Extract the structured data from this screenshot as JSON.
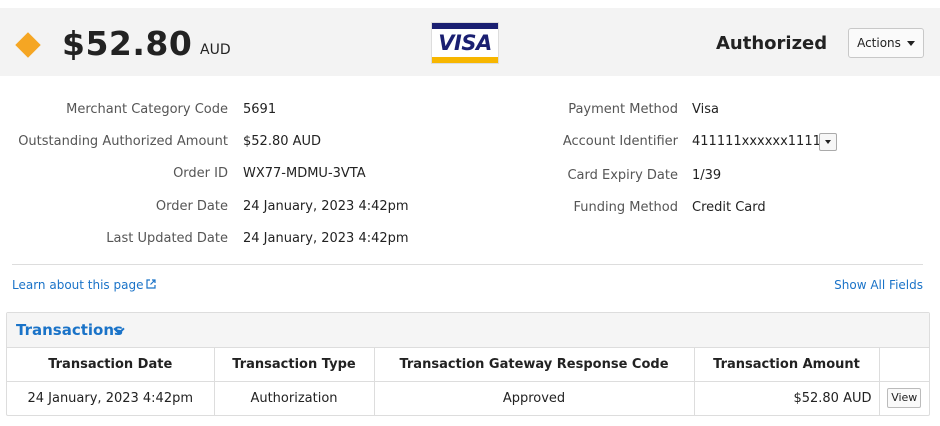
{
  "header": {
    "amount": "$52.80",
    "currency": "AUD",
    "card_brand": "VISA",
    "status": "Authorized",
    "actions_label": "Actions",
    "status_icon_color": "#f5a623",
    "brand_blue": "#1a1f71",
    "brand_gold": "#f7b600"
  },
  "details_left": [
    {
      "label": "Merchant Category Code",
      "value": "5691"
    },
    {
      "label": "Outstanding Authorized Amount",
      "value": "$52.80 AUD"
    },
    {
      "label": "Order ID",
      "value": "WX77-MDMU-3VTA"
    },
    {
      "label": "Order Date",
      "value": "24 January, 2023 4:42pm"
    },
    {
      "label": "Last Updated Date",
      "value": "24 January, 2023 4:42pm"
    }
  ],
  "details_right": [
    {
      "label": "Payment Method",
      "value": "Visa"
    },
    {
      "label": "Account Identifier",
      "value": "411111xxxxxx1111"
    },
    {
      "label": "Card Expiry Date",
      "value": "1/39"
    },
    {
      "label": "Funding Method",
      "value": "Credit Card"
    }
  ],
  "links": {
    "learn": "Learn about this page",
    "show_all": "Show All Fields"
  },
  "transactions": {
    "title": "Transactions",
    "columns": [
      "Transaction Date",
      "Transaction Type",
      "Transaction Gateway Response Code",
      "Transaction Amount",
      ""
    ],
    "rows": [
      {
        "date": "24 January, 2023 4:42pm",
        "type": "Authorization",
        "response": "Approved",
        "amount": "$52.80 AUD",
        "action": "View"
      }
    ]
  },
  "colors": {
    "link": "#1a73c8",
    "header_bg": "#f3f3f3"
  }
}
